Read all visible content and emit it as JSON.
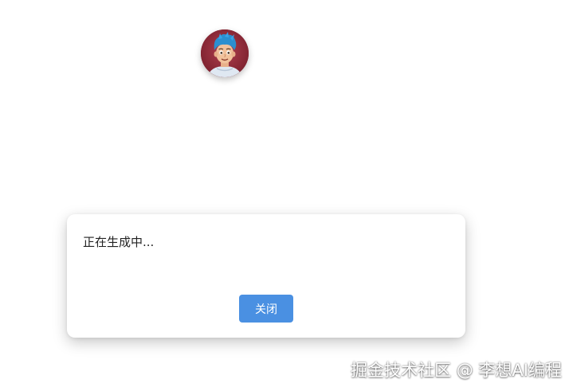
{
  "modal": {
    "message": "正在生成中...",
    "close_label": "关闭"
  },
  "watermark": {
    "text": "掘金技术社区 @ 李想AI编程"
  },
  "colors": {
    "button_primary": "#4a90e2",
    "avatar_background": "#8c2a38",
    "avatar_hair": "#2a8fd0"
  },
  "icons": {
    "avatar": "cartoon-boy-avatar"
  }
}
